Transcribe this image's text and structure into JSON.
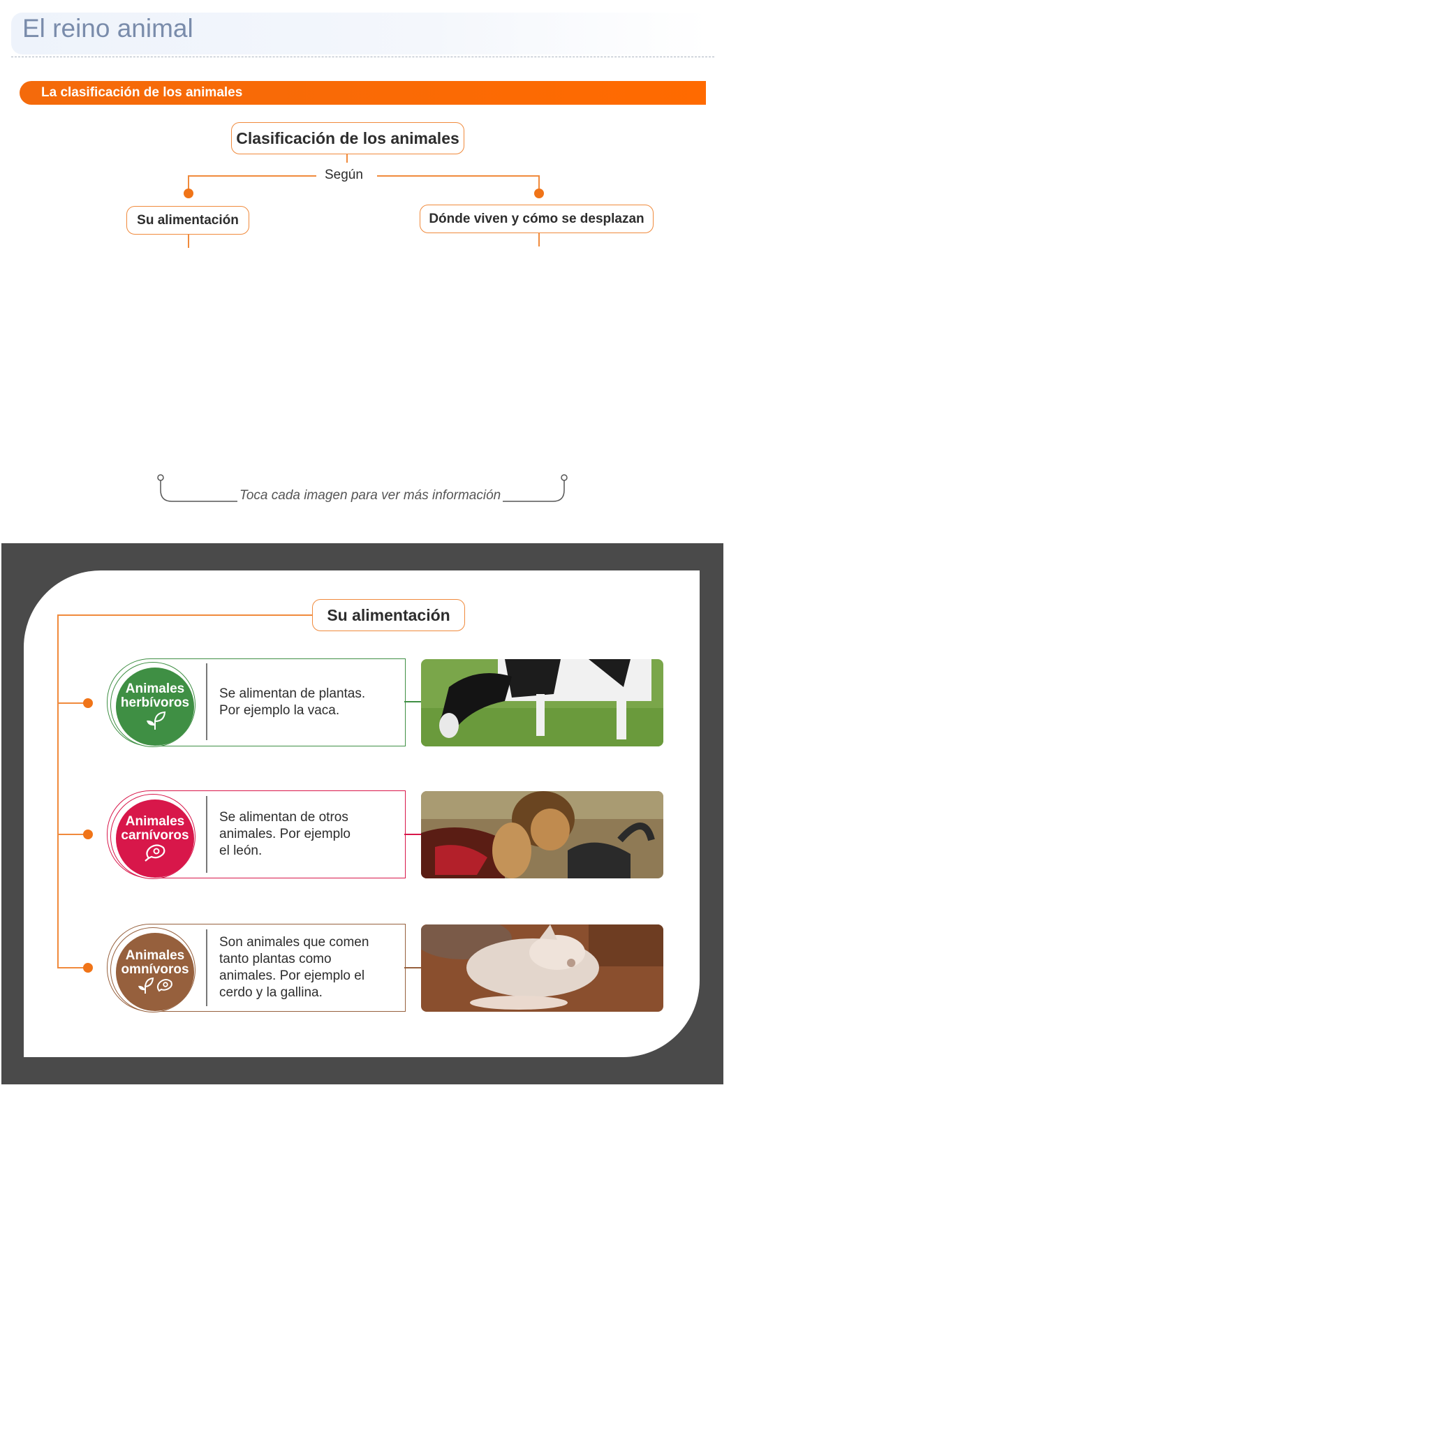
{
  "header": {
    "title": "El reino animal"
  },
  "section": {
    "label": "La clasificación de los animales"
  },
  "diagram": {
    "root": "Clasificación de los animales",
    "connector": "Según",
    "left": "Su alimentación",
    "right": "Dónde viven y cómo se desplazan"
  },
  "hint": "Toca cada imagen para ver más información",
  "panel": {
    "title": "Su alimentación",
    "rows": [
      {
        "badge_line1": "Animales",
        "badge_line2": "herbívoros",
        "color": "#3f8f44",
        "icon": "leaf-icon",
        "text": [
          "Se alimentan de plantas.",
          "Por ejemplo la vaca."
        ],
        "image": "cow-grazing-photo"
      },
      {
        "badge_line1": "Animales",
        "badge_line2": "carnívoros",
        "color": "#d8174a",
        "icon": "meat-icon",
        "text": [
          "Se alimentan de otros",
          "animales. Por ejemplo",
          "el león."
        ],
        "image": "lions-eating-photo"
      },
      {
        "badge_line1": "Animales",
        "badge_line2": "omnívoros",
        "color": "#96603d",
        "icon": "leaf-and-meat-icon",
        "text": [
          "Son animales que comen",
          "tanto plantas como",
          "animales. Por ejemplo el",
          "cerdo y la gallina."
        ],
        "image": "pig-in-mud-photo"
      }
    ]
  }
}
